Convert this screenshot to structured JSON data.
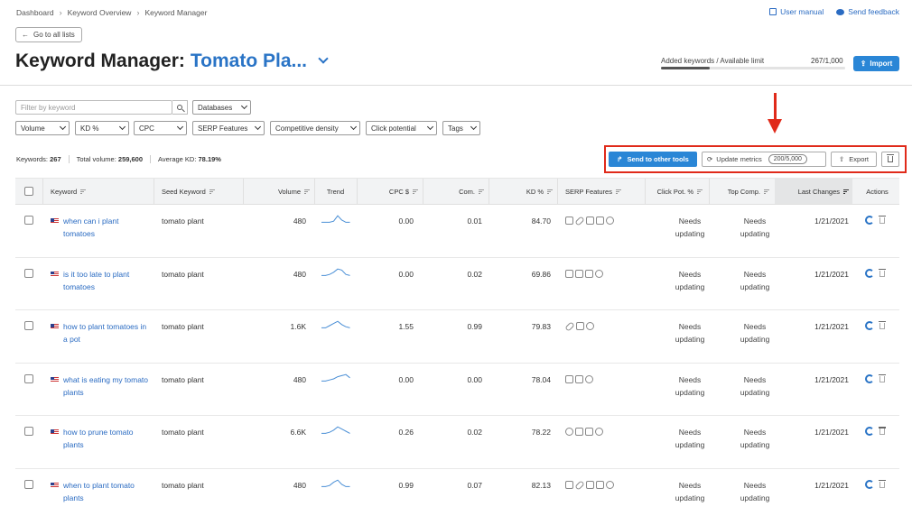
{
  "breadcrumbs": [
    "Dashboard",
    "Keyword Overview",
    "Keyword Manager"
  ],
  "top_links": {
    "manual": "User manual",
    "feedback": "Send feedback"
  },
  "back_label": "Go to all lists",
  "title": {
    "prefix": "Keyword Manager:",
    "list_name": "Tomato Pla..."
  },
  "limit": {
    "label": "Added keywords / Available limit",
    "value": "267/1,000",
    "fraction": 0.267
  },
  "import_label": "Import",
  "filters": {
    "placeholder": "Filter by keyword",
    "databases": "Databases",
    "dropdowns": [
      "Volume",
      "KD %",
      "CPC",
      "SERP Features",
      "Competitive density",
      "Click potential",
      "Tags"
    ]
  },
  "summary": {
    "keywords_label": "Keywords:",
    "keywords": "267",
    "volume_label": "Total volume:",
    "volume": "259,600",
    "kd_label": "Average KD:",
    "kd": "78.19%"
  },
  "actions": {
    "send": "Send to other tools",
    "update": "Update metrics",
    "update_count": "200/5,000",
    "export": "Export"
  },
  "columns": [
    "Keyword",
    "Seed Keyword",
    "Volume",
    "Trend",
    "CPC $",
    "Com.",
    "KD %",
    "SERP Features",
    "Click Pot. %",
    "Top Comp.",
    "Last Changes",
    "Actions"
  ],
  "rows": [
    {
      "keyword": "when can i plant tomatoes",
      "seed": "tomato plant",
      "volume": "480",
      "cpc": "0.00",
      "com": "0.01",
      "kd": "84.70",
      "serp": [
        "crown-icon",
        "link-icon",
        "image-icon",
        "faq-icon",
        "video-icon"
      ],
      "click1": "Needs",
      "click2": "updating",
      "top1": "Needs",
      "top2": "updating",
      "date": "1/21/2021",
      "trend": [
        3,
        3,
        3,
        4,
        9,
        5,
        3,
        3
      ]
    },
    {
      "keyword": "is it too late to plant tomatoes",
      "seed": "tomato plant",
      "volume": "480",
      "cpc": "0.00",
      "com": "0.02",
      "kd": "69.86",
      "serp": [
        "crown-icon",
        "image-icon",
        "faq-icon",
        "video-icon"
      ],
      "click1": "Needs",
      "click2": "updating",
      "top1": "Needs",
      "top2": "updating",
      "date": "1/21/2021",
      "trend": [
        3,
        3,
        4,
        6,
        9,
        8,
        4,
        3
      ]
    },
    {
      "keyword": "how to plant tomatoes in a pot",
      "seed": "tomato plant",
      "volume": "1.6K",
      "cpc": "1.55",
      "com": "0.99",
      "kd": "79.83",
      "serp": [
        "link-icon",
        "faq-icon",
        "video-icon"
      ],
      "click1": "Needs",
      "click2": "updating",
      "top1": "Needs",
      "top2": "updating",
      "date": "1/21/2021",
      "trend": [
        3,
        3,
        5,
        7,
        9,
        6,
        4,
        3
      ]
    },
    {
      "keyword": "what is eating my tomato plants",
      "seed": "tomato plant",
      "volume": "480",
      "cpc": "0.00",
      "com": "0.00",
      "kd": "78.04",
      "serp": [
        "crown-icon",
        "faq-icon",
        "video-icon"
      ],
      "click1": "Needs",
      "click2": "updating",
      "top1": "Needs",
      "top2": "updating",
      "date": "1/21/2021",
      "trend": [
        3,
        3,
        4,
        5,
        7,
        8,
        9,
        6
      ]
    },
    {
      "keyword": "how to prune tomato plants",
      "seed": "tomato plant",
      "volume": "6.6K",
      "cpc": "0.26",
      "com": "0.02",
      "kd": "78.22",
      "serp": [
        "video-icon",
        "faq-icon",
        "image-icon",
        "video-icon"
      ],
      "click1": "Needs",
      "click2": "updating",
      "top1": "Needs",
      "top2": "updating",
      "date": "1/21/2021",
      "trend": [
        3,
        3,
        4,
        6,
        9,
        7,
        5,
        3
      ]
    },
    {
      "keyword": "when to plant tomato plants",
      "seed": "tomato plant",
      "volume": "480",
      "cpc": "0.99",
      "com": "0.07",
      "kd": "82.13",
      "serp": [
        "crown-icon",
        "link-icon",
        "image-icon",
        "faq-icon",
        "video-icon"
      ],
      "click1": "Needs",
      "click2": "updating",
      "top1": "Needs",
      "top2": "updating",
      "date": "1/21/2021",
      "trend": [
        3,
        3,
        4,
        7,
        9,
        5,
        3,
        3
      ]
    }
  ],
  "colors": {
    "accent": "#2a86d6",
    "link": "#2a6bc2",
    "highlight": "#e02a1a"
  }
}
